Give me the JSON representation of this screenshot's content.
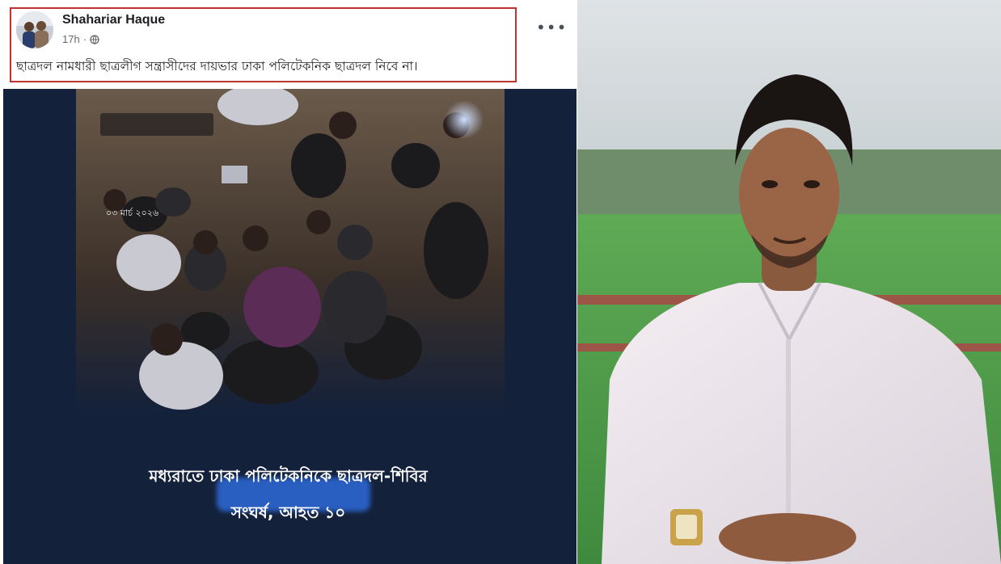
{
  "post": {
    "author": "Shahariar Haque",
    "time": "17h",
    "privacy_separator": "·",
    "privacy_icon": "globe-icon",
    "text": "ছাত্রদল নামধারী ছাত্রলীগ সন্ত্রাসীদের দায়ভার ঢাকা পলিটেকনিক ছাত্রদল নিবে না।",
    "more_icon": "more-horizontal-icon",
    "highlight_color": "#c0342f"
  },
  "video": {
    "date_stamp": "০৩ মার্চ ২০২৬",
    "blurred_label": "",
    "caption_line1": "মধ্যরাতে ঢাকা পলিটেকনিকে ছাত্রদল-শিবির",
    "caption_line2": "সংঘর্ষ, আহত ১০",
    "background_color": "#14213a"
  },
  "photo": {
    "description_icon": "portrait-photo"
  }
}
